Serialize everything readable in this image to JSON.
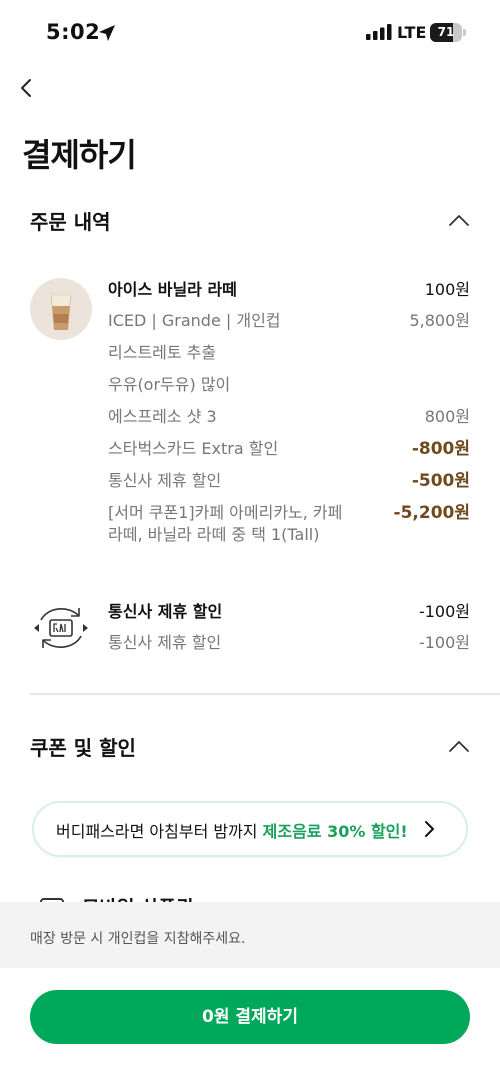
{
  "status_bar": {
    "time": "5:02",
    "network": "LTE",
    "battery_level": 71,
    "battery_text": "71"
  },
  "header": {
    "title": "결제하기"
  },
  "order_section": {
    "title": "주문 내역",
    "item": {
      "name": "아이스 바닐라 라떼",
      "quantity_price": "100원",
      "options": [
        {
          "label": "ICED | Grande | 개인컵",
          "value": "5,800원"
        },
        {
          "label": "리스트레토 추출",
          "value": ""
        },
        {
          "label": "우유(or두유) 많이",
          "value": ""
        },
        {
          "label": "에스프레소 샷 3",
          "value": "800원"
        },
        {
          "label": "스타벅스카드 Extra 할인",
          "value": "-800원"
        },
        {
          "label": "통신사 제휴 할인",
          "value": "-500원"
        },
        {
          "label": "[서머 쿠폰1]카페 아메리카노, 카페",
          "label_line2": "라떼, 바닐라 라떼 중 택 1(Tall)",
          "value": "-5,200원"
        }
      ]
    },
    "telecom": {
      "name": "통신사 제휴 할인",
      "value": "-100원",
      "sub_label": "통신사 제휴 할인",
      "sub_value": "-100원"
    }
  },
  "coupon_section": {
    "title": "쿠폰 및 할인",
    "promo_prefix": "버디패스라면 아침부터 밤까지 ",
    "promo_highlight": "제조음료 30% 할인!",
    "partial_option": "모바일 상품권"
  },
  "footer": {
    "notice": "매장 방문 시 개인컵을 지참해주세요.",
    "pay_button": "0원 결제하기"
  },
  "colors": {
    "brand_green": "#00a85a",
    "promo_green": "#1aa05a",
    "discount_brown": "#6f4a1e"
  },
  "icons": [
    "location-arrow-icon",
    "signal-icon",
    "battery-icon",
    "back-arrow-icon",
    "chevron-up-icon",
    "telecom-exchange-icon",
    "chevron-right-icon",
    "checkbox-icon"
  ]
}
